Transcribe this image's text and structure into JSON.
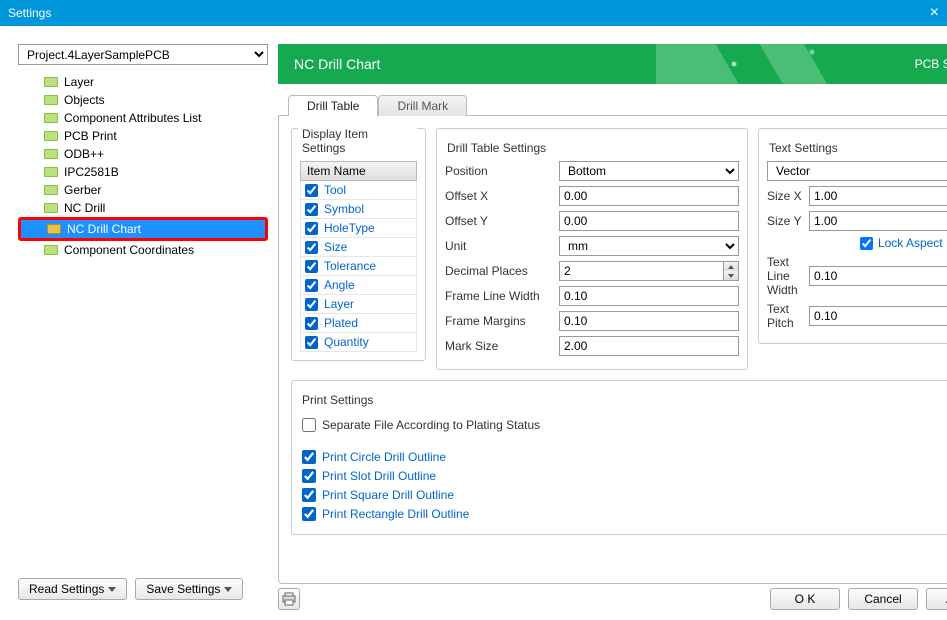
{
  "window": {
    "title": "Settings"
  },
  "project_selector": {
    "value": "Project.4LayerSamplePCB"
  },
  "tree": {
    "items": [
      {
        "label": "Layer"
      },
      {
        "label": "Objects"
      },
      {
        "label": "Component Attributes List"
      },
      {
        "label": "PCB Print"
      },
      {
        "label": "ODB++"
      },
      {
        "label": "IPC2581B"
      },
      {
        "label": "Gerber"
      },
      {
        "label": "NC Drill"
      },
      {
        "label": "NC Drill Chart"
      },
      {
        "label": "Component Coordinates"
      }
    ],
    "selected_index": 8
  },
  "left_buttons": {
    "read": "Read Settings",
    "save": "Save Settings"
  },
  "banner": {
    "title": "NC Drill Chart",
    "subtitle": "PCB Setting"
  },
  "tabs": {
    "t1": "Drill Table",
    "t2": "Drill Mark",
    "active": "t1"
  },
  "display_items": {
    "group_title": "Display Item Settings",
    "header": "Item Name",
    "items": [
      "Tool",
      "Symbol",
      "HoleType",
      "Size",
      "Tolerance",
      "Angle",
      "Layer",
      "Plated",
      "Quantity"
    ]
  },
  "drill_table": {
    "group_title": "Drill Table Settings",
    "position_label": "Position",
    "position_value": "Bottom",
    "offsetx_label": "Offset X",
    "offsetx_value": "0.00",
    "offsety_label": "Offset Y",
    "offsety_value": "0.00",
    "unit_label": "Unit",
    "unit_value": "mm",
    "dec_label": "Decimal Places",
    "dec_value": "2",
    "flw_label": "Frame Line Width",
    "flw_value": "0.10",
    "fm_label": "Frame Margins",
    "fm_value": "0.10",
    "ms_label": "Mark Size",
    "ms_value": "2.00"
  },
  "text_settings": {
    "group_title": "Text Settings",
    "font_value": "Vector",
    "sx_label": "Size X",
    "sx_value": "1.00",
    "sy_label": "Size Y",
    "sy_value": "1.00",
    "lock_label": "Lock Aspect Ratio",
    "tlw_label": "Text Line Width",
    "tlw_value": "0.10",
    "tp_label": "Text Pitch",
    "tp_value": "0.10"
  },
  "print_settings": {
    "group_title": "Print Settings",
    "separate": "Separate File According to Plating Status",
    "o1": "Print Circle Drill Outline",
    "o2": "Print Slot Drill Outline",
    "o3": "Print Square Drill Outline",
    "o4": "Print Rectangle Drill Outline"
  },
  "action_buttons": {
    "ok": "O K",
    "cancel": "Cancel",
    "apply": "Apply"
  }
}
